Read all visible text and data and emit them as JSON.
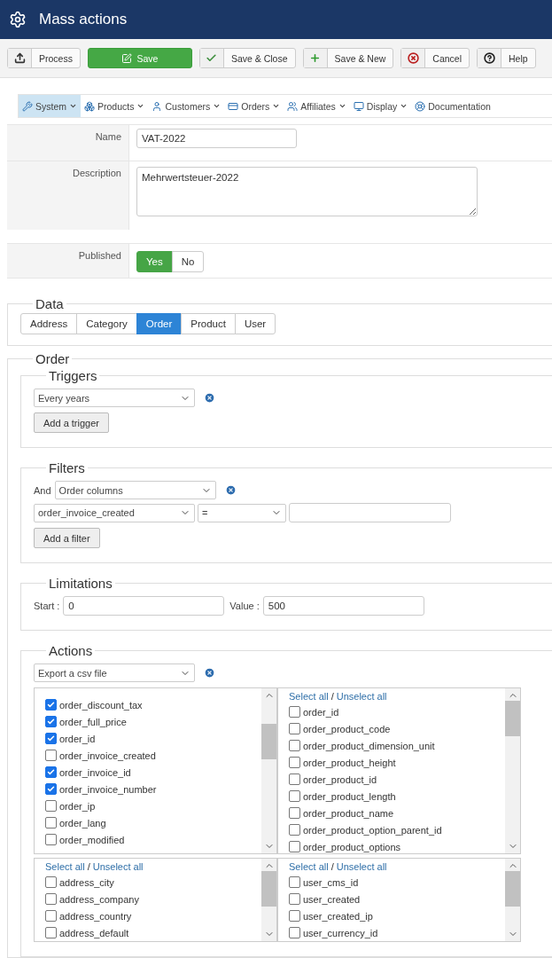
{
  "header": {
    "title": "Mass actions"
  },
  "toolbar": [
    {
      "label": "Process",
      "kind": "default"
    },
    {
      "label": "Save",
      "kind": "primary"
    },
    {
      "label": "Save & Close",
      "kind": "default"
    },
    {
      "label": "Save & New",
      "kind": "default"
    },
    {
      "label": "Cancel",
      "kind": "default"
    },
    {
      "label": "Help",
      "kind": "default"
    }
  ],
  "nav": [
    {
      "label": "System",
      "selected": true
    },
    {
      "label": "Products",
      "selected": false
    },
    {
      "label": "Customers",
      "selected": false
    },
    {
      "label": "Orders",
      "selected": false
    },
    {
      "label": "Affiliates",
      "selected": false
    },
    {
      "label": "Display",
      "selected": false
    },
    {
      "label": "Documentation",
      "selected": false
    }
  ],
  "form": {
    "name_label": "Name",
    "name_value": "VAT-2022",
    "description_label": "Description",
    "description_value": "Mehrwertsteuer-2022",
    "published_label": "Published",
    "published_options": [
      {
        "label": "Yes",
        "selected": true
      },
      {
        "label": "No",
        "selected": false
      }
    ]
  },
  "data": {
    "legend": "Data",
    "tabs": [
      {
        "label": "Address",
        "selected": false
      },
      {
        "label": "Category",
        "selected": false
      },
      {
        "label": "Order",
        "selected": true
      },
      {
        "label": "Product",
        "selected": false
      },
      {
        "label": "User",
        "selected": false
      }
    ]
  },
  "order": {
    "legend": "Order",
    "triggers": {
      "legend": "Triggers",
      "select": "Every years",
      "button": "Add a trigger"
    },
    "filters": {
      "legend": "Filters",
      "and_label": "And",
      "type_select": "Order columns",
      "column_select": "order_invoice_created",
      "operator_select": "=",
      "button": "Add a filter"
    },
    "limitations": {
      "legend": "Limitations",
      "start_label": "Start :",
      "start_value": "0",
      "value_label": "Value :",
      "value_value": "500"
    },
    "actions": {
      "legend": "Actions",
      "select": "Export a csv file",
      "lists": [
        {
          "items": [
            {
              "label": "order_discount_tax",
              "checked": true
            },
            {
              "label": "order_full_price",
              "checked": true
            },
            {
              "label": "order_id",
              "checked": true
            },
            {
              "label": "order_invoice_created",
              "checked": false
            },
            {
              "label": "order_invoice_id",
              "checked": true
            },
            {
              "label": "order_invoice_number",
              "checked": true
            },
            {
              "label": "order_ip",
              "checked": false
            },
            {
              "label": "order_lang",
              "checked": false
            },
            {
              "label": "order_modified",
              "checked": false
            }
          ]
        },
        {
          "select_all": "Select all",
          "separator": "/",
          "unselect_all": "Unselect all",
          "items": [
            {
              "label": "order_id",
              "checked": false
            },
            {
              "label": "order_product_code",
              "checked": false
            },
            {
              "label": "order_product_dimension_unit",
              "checked": false
            },
            {
              "label": "order_product_height",
              "checked": false
            },
            {
              "label": "order_product_id",
              "checked": false
            },
            {
              "label": "order_product_length",
              "checked": false
            },
            {
              "label": "order_product_name",
              "checked": false
            },
            {
              "label": "order_product_option_parent_id",
              "checked": false
            },
            {
              "label": "order_product_options",
              "checked": false
            }
          ]
        },
        {
          "select_all": "Select all",
          "separator": "/",
          "unselect_all": "Unselect all",
          "items": [
            {
              "label": "address_city",
              "checked": false
            },
            {
              "label": "address_company",
              "checked": false
            },
            {
              "label": "address_country",
              "checked": false
            },
            {
              "label": "address_default",
              "checked": false
            }
          ]
        },
        {
          "select_all": "Select all",
          "separator": "/",
          "unselect_all": "Unselect all",
          "items": [
            {
              "label": "user_cms_id",
              "checked": false
            },
            {
              "label": "user_created",
              "checked": false
            },
            {
              "label": "user_created_ip",
              "checked": false
            },
            {
              "label": "user_currency_id",
              "checked": false
            }
          ]
        }
      ]
    }
  }
}
